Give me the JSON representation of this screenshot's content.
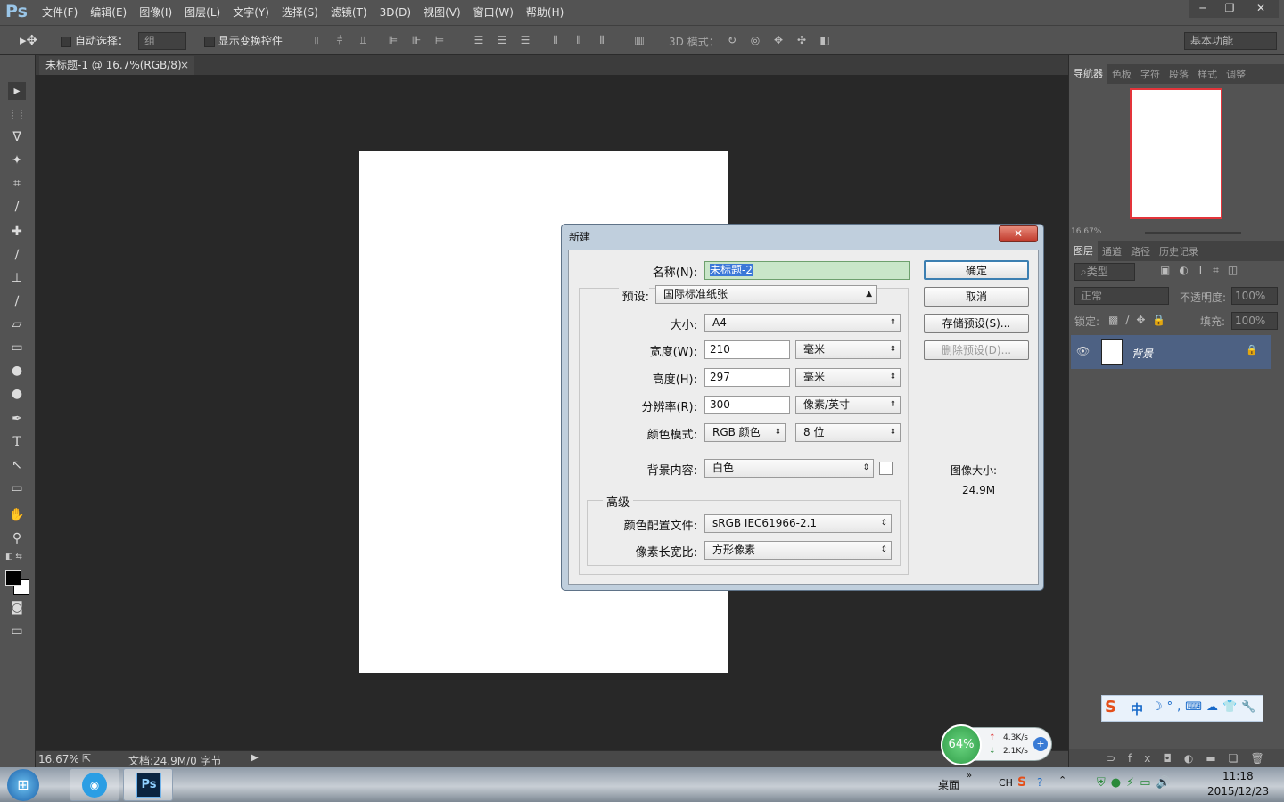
{
  "app": {
    "logo": "Ps",
    "menus": [
      "文件(F)",
      "编辑(E)",
      "图像(I)",
      "图层(L)",
      "文字(Y)",
      "选择(S)",
      "滤镜(T)",
      "3D(D)",
      "视图(V)",
      "窗口(W)",
      "帮助(H)"
    ],
    "window_controls": [
      "─",
      "❐",
      "✕"
    ]
  },
  "options": {
    "auto_select_label": "自动选择：",
    "auto_select_value": "组",
    "show_transform_label": "显示变换控件",
    "mode_3d_label": "3D 模式：",
    "workspace": "基本功能"
  },
  "document": {
    "tab_title": "未标题-1 @ 16.7%(RGB/8)",
    "tab_close": "×"
  },
  "status": {
    "zoom": "16.67%",
    "doc_info": "文档:24.9M/0 字节"
  },
  "navigator": {
    "tabs": [
      "导航器",
      "色板",
      "字符",
      "段落",
      "样式",
      "调整"
    ],
    "zoom": "16.67%"
  },
  "layers": {
    "tabs": [
      "图层",
      "通道",
      "路径",
      "历史记录"
    ],
    "filter_label": "类型",
    "blend_mode": "正常",
    "opacity_label": "不透明度:",
    "opacity_value": "100%",
    "lock_label": "锁定:",
    "fill_label": "填充:",
    "fill_value": "100%",
    "layer_name": "背景"
  },
  "dialog": {
    "title": "新建",
    "close": "✕",
    "name_label": "名称(N):",
    "name_value": "未标题-2",
    "preset_label": "预设:",
    "preset_value": "国际标准纸张",
    "size_label": "大小:",
    "size_value": "A4",
    "width_label": "宽度(W):",
    "width_value": "210",
    "width_unit": "毫米",
    "height_label": "高度(H):",
    "height_value": "297",
    "height_unit": "毫米",
    "resolution_label": "分辨率(R):",
    "resolution_value": "300",
    "resolution_unit": "像素/英寸",
    "color_mode_label": "颜色模式:",
    "color_mode_value": "RGB 颜色",
    "bit_depth": "8 位",
    "bg_label": "背景内容:",
    "bg_value": "白色",
    "advanced_label": "高级",
    "profile_label": "颜色配置文件:",
    "profile_value": "sRGB IEC61966-2.1",
    "aspect_label": "像素长宽比:",
    "aspect_value": "方形像素",
    "ok": "确定",
    "cancel": "取消",
    "save_preset": "存储预设(S)...",
    "delete_preset": "删除预设(D)...",
    "image_size_label": "图像大小:",
    "image_size_value": "24.9M"
  },
  "widget": {
    "percent": "64%",
    "up": "4.3K/s",
    "down": "2.1K/s"
  },
  "ime": {
    "lang": "中"
  },
  "taskbar": {
    "desktop": "桌面",
    "lang": "CH",
    "time": "11:18",
    "date": "2015/12/23"
  }
}
